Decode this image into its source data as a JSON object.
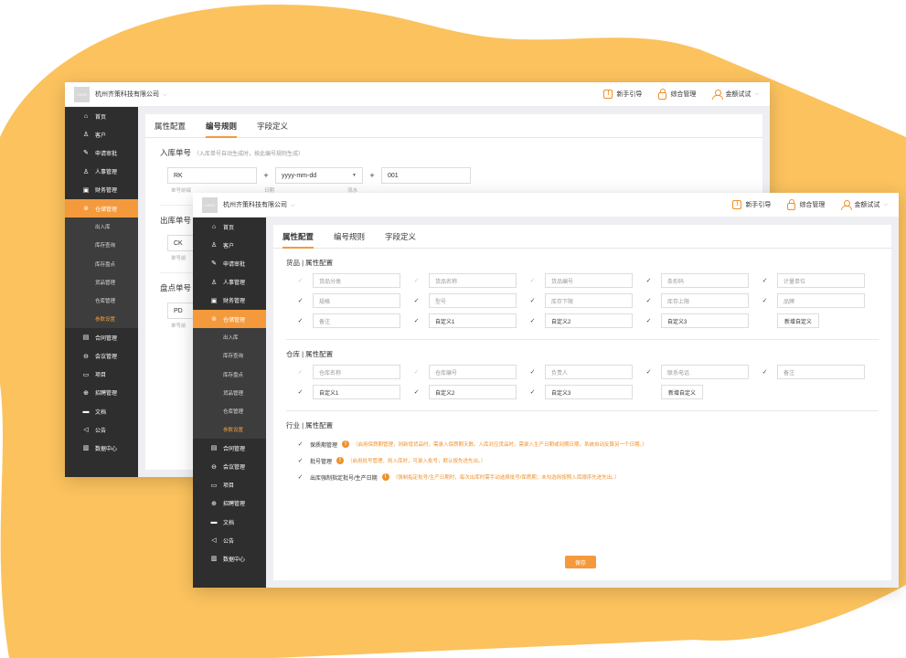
{
  "colors": {
    "accent": "#f49a3c",
    "sidebar": "#2e2e2e",
    "blob": "#fbc25e",
    "warning": "#f0902a"
  },
  "company": "杭州齐策科技有限公司",
  "logo": "LOGO",
  "topbar": {
    "guide": "新手引导",
    "guide_icon": "guide-icon",
    "admin": "综合管理",
    "admin_icon": "lock-icon",
    "user": "金额试试",
    "user_icon": "user-icon"
  },
  "sidebar": {
    "items": [
      {
        "label": "首页",
        "icon": "⌂"
      },
      {
        "label": "客户",
        "icon": "♙"
      },
      {
        "label": "申请审批",
        "icon": "✎"
      },
      {
        "label": "人事管理",
        "icon": "♙"
      },
      {
        "label": "财务管理",
        "icon": "▣"
      },
      {
        "label": "仓储管理",
        "icon": "⊚"
      }
    ],
    "sub": [
      "出入库",
      "库存查询",
      "库存盘点",
      "货品管理",
      "仓库管理",
      "参数设置"
    ],
    "items2": [
      {
        "label": "合同管理",
        "icon": "▤"
      },
      {
        "label": "会议管理",
        "icon": "⊖"
      },
      {
        "label": "项目",
        "icon": "▭"
      },
      {
        "label": "招聘管理",
        "icon": "⊕"
      },
      {
        "label": "文档",
        "icon": "▬"
      },
      {
        "label": "公告",
        "icon": "◁"
      },
      {
        "label": "数据中心",
        "icon": "▥"
      }
    ]
  },
  "tabs": [
    "属性配置",
    "编号规则",
    "字段定义"
  ],
  "back": {
    "inbound_label": "入库单号",
    "inbound_hint": "（入库单号自动生成时，按此编号规则生成）",
    "prefix_value": "RK",
    "date_value": "yyyy-mm-dd",
    "seq_value": "001",
    "cap_prefix": "单号前缀",
    "cap_date": "日期",
    "cap_seq": "流水",
    "outbound_label": "出库单号",
    "outbound_value": "CK",
    "outbound_cap": "单号前",
    "count_label": "盘点单号",
    "count_value": "PD",
    "count_cap": "单号前"
  },
  "goods": {
    "title": "货品 | 属性配置",
    "fields": [
      {
        "label": "货品分类",
        "ph": true,
        "dis": true
      },
      {
        "label": "货品名称",
        "ph": true,
        "dis": true
      },
      {
        "label": "货品编号",
        "ph": true,
        "dis": true
      },
      {
        "label": "条形码",
        "ph": true,
        "dis": false
      },
      {
        "label": "计量单位",
        "ph": true,
        "dis": false
      },
      {
        "label": "规格",
        "ph": true,
        "dis": false
      },
      {
        "label": "型号",
        "ph": true,
        "dis": false
      },
      {
        "label": "库存下限",
        "ph": true,
        "dis": false
      },
      {
        "label": "库存上限",
        "ph": true,
        "dis": false
      },
      {
        "label": "品牌",
        "ph": true,
        "dis": false
      },
      {
        "label": "备注",
        "ph": true,
        "dis": false
      },
      {
        "label": "自定义1",
        "ph": false,
        "dis": false
      },
      {
        "label": "自定义2",
        "ph": false,
        "dis": false
      },
      {
        "label": "自定义3",
        "ph": false,
        "dis": false
      }
    ],
    "add": "新增自定义"
  },
  "warehouse": {
    "title": "仓库 | 属性配置",
    "fields": [
      {
        "label": "仓库名称",
        "ph": true,
        "dis": true
      },
      {
        "label": "仓库编号",
        "ph": true,
        "dis": true
      },
      {
        "label": "负责人",
        "ph": true,
        "dis": false
      },
      {
        "label": "联系电话",
        "ph": true,
        "dis": false
      },
      {
        "label": "备注",
        "ph": true,
        "dis": false
      },
      {
        "label": "自定义1",
        "ph": false,
        "dis": false
      },
      {
        "label": "自定义2",
        "ph": false,
        "dis": false
      },
      {
        "label": "自定义3",
        "ph": false,
        "dis": false
      }
    ],
    "add": "新增自定义"
  },
  "industry": {
    "title": "行业 | 属性配置",
    "lines": [
      {
        "label": "保质期管理",
        "note": "（启用保质期管理，则新增货品时，需录入保质期天数。入库对应货品时，需录入生产日期或到期日期，系统自动反算另一个日期。）"
      },
      {
        "label": "批号管理",
        "note": "（启用批号管理，则入库时，可录入批号，默认按先进先出。）"
      },
      {
        "label": "出库强制指定批号/生产日期",
        "note": "（强制指定批号/生产日期时，每次出库时需手动选择批号/保质期；未勾选则按照入库顺序先进先出。）"
      }
    ]
  },
  "save": "保存"
}
